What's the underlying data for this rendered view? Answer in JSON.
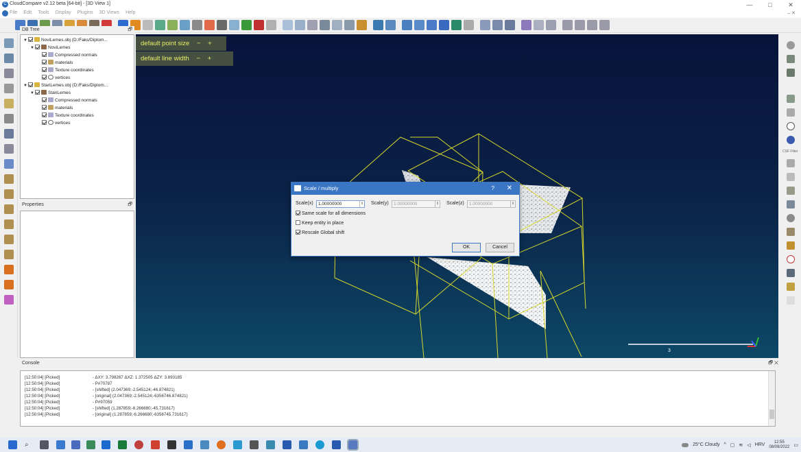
{
  "window": {
    "title": "CloudCompare v2.12 beta [64-bit] - [3D View 1]",
    "minimize": "—",
    "maximize": "□",
    "close": "✕"
  },
  "menu": {
    "items": [
      "File",
      "Edit",
      "Tools",
      "Display",
      "Plugins",
      "3D Views",
      "Help"
    ],
    "mdi_controls": "– ✕"
  },
  "db_tree": {
    "title": "DB Tree",
    "nodes": [
      {
        "label": "NoviLemes.obj (D:/Faks/Diplom...",
        "level": 0,
        "icon": "folder-icon"
      },
      {
        "label": "NoviLemes",
        "level": 1,
        "icon": "mesh-icon"
      },
      {
        "label": "Compressed normals",
        "level": 2,
        "icon": "normals-icon"
      },
      {
        "label": "materials",
        "level": 2,
        "icon": "materials-icon"
      },
      {
        "label": "Texture coordinates",
        "level": 2,
        "icon": "texture-icon"
      },
      {
        "label": "vertices",
        "level": 2,
        "icon": "cloud-icon"
      },
      {
        "label": "StariLemes.obj (D:/Faks/Diplom...",
        "level": 0,
        "icon": "folder-icon"
      },
      {
        "label": "StariLemes",
        "level": 1,
        "icon": "mesh-icon"
      },
      {
        "label": "Compressed normals",
        "level": 2,
        "icon": "normals-icon"
      },
      {
        "label": "materials",
        "level": 2,
        "icon": "materials-icon"
      },
      {
        "label": "Texture coordinates",
        "level": 2,
        "icon": "texture-icon"
      },
      {
        "label": "vertices",
        "level": 2,
        "icon": "cloud-icon"
      }
    ]
  },
  "properties": {
    "title": "Properties"
  },
  "view3d": {
    "point_size_label": "default point size",
    "line_width_label": "default line width",
    "minus": "−",
    "plus": "+",
    "scale_value": "3"
  },
  "dialog": {
    "title": "Scale / multiply",
    "help": "?",
    "close": "✕",
    "scale_x_label": "Scale(x)",
    "scale_x_value": "1.00000000",
    "scale_y_label": "Scale(y)",
    "scale_y_value": "1.00000000",
    "scale_z_label": "Scale(z)",
    "scale_z_value": "1.00000000",
    "same_scale_label": "Same scale for all dimensions",
    "same_scale_checked": true,
    "keep_in_place_label": "Keep entity in place",
    "keep_in_place_checked": false,
    "rescale_shift_label": "Rescale Global shift",
    "rescale_shift_checked": true,
    "ok": "OK",
    "cancel": "Cancel"
  },
  "console": {
    "title": "Console",
    "controls": "🗗 ✕",
    "lines": [
      {
        "time": "[12:50:04] [Picked]",
        "msg": "- ΔXY: 3.798267              ΔXZ: 1.372505  ΔZY: 3.893185"
      },
      {
        "time": "[12:50:04] [Picked]",
        "msg": "- P#70787"
      },
      {
        "time": "[12:50:04] [Picked]",
        "msg": "-  [shifted] (2.047369;-2.545124;-46.874821)"
      },
      {
        "time": "[12:50:04] [Picked]",
        "msg": "-  [original] (2.047369;-2.545124;-6356746.874821)"
      },
      {
        "time": "[12:50:04] [Picked]",
        "msg": "- P#97059"
      },
      {
        "time": "[12:50:04] [Picked]",
        "msg": "-  [shifted] (1.287859;-6.266680;-45.731617)"
      },
      {
        "time": "[12:50:04] [Picked]",
        "msg": "-  [original] (1.287859;-6.266680;-6356745.731617)"
      }
    ]
  },
  "taskbar": {
    "weather": "25°C  Cloudy",
    "lang": "HRV",
    "time": "12:55",
    "date": "08/09/2022"
  }
}
